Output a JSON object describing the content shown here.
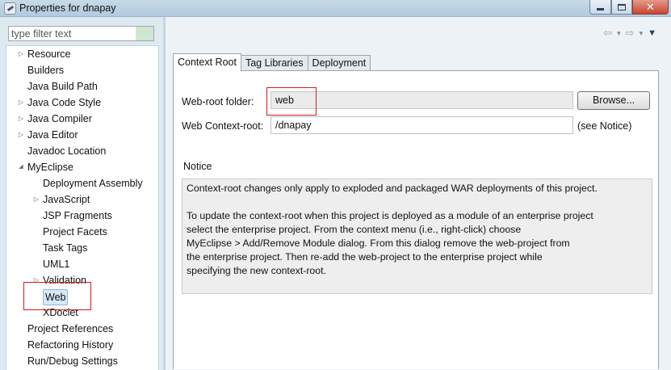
{
  "window": {
    "title": "Properties for dnapay"
  },
  "filter": {
    "placeholder": "type filter text"
  },
  "tree": {
    "items": [
      {
        "label": "Resource",
        "expander": "collapsed"
      },
      {
        "label": "Builders",
        "expander": "none"
      },
      {
        "label": "Java Build Path",
        "expander": "none"
      },
      {
        "label": "Java Code Style",
        "expander": "collapsed"
      },
      {
        "label": "Java Compiler",
        "expander": "collapsed"
      },
      {
        "label": "Java Editor",
        "expander": "collapsed"
      },
      {
        "label": "Javadoc Location",
        "expander": "none"
      },
      {
        "label": "MyEclipse",
        "expander": "expanded"
      },
      {
        "label": "Deployment Assembly",
        "expander": "none"
      },
      {
        "label": "JavaScript",
        "expander": "collapsed"
      },
      {
        "label": "JSP Fragments",
        "expander": "none"
      },
      {
        "label": "Project Facets",
        "expander": "none"
      },
      {
        "label": "Task Tags",
        "expander": "none"
      },
      {
        "label": "UML1",
        "expander": "none"
      },
      {
        "label": "Validation",
        "expander": "collapsed"
      },
      {
        "label": "Web",
        "expander": "none",
        "selected": true
      },
      {
        "label": "XDoclet",
        "expander": "none"
      },
      {
        "label": "Project References",
        "expander": "none"
      },
      {
        "label": "Refactoring History",
        "expander": "none"
      },
      {
        "label": "Run/Debug Settings",
        "expander": "none"
      }
    ]
  },
  "tabs": [
    {
      "label": "Context Root",
      "active": true
    },
    {
      "label": "Tag Libraries",
      "active": false
    },
    {
      "label": "Deployment",
      "active": false
    }
  ],
  "context_root": {
    "web_root_label": "Web-root folder:",
    "web_root_value": "web",
    "browse_label": "Browse...",
    "context_root_label": "Web Context-root:",
    "context_root_value": "/dnapay",
    "see_notice": "(see Notice)"
  },
  "notice": {
    "heading": "Notice",
    "para1": "Context-root changes only apply to exploded and packaged WAR deployments of this project.",
    "para2_lines": [
      "To update the context-root when this project is deployed as a module of an enterprise project",
      "select the enterprise project. From the context menu (i.e., right-click) choose",
      "MyEclipse > Add/Remove Module dialog. From this dialog remove the web-project from",
      "the enterprise project. Then re-add the web-project to the enterprise project while",
      "specifying the new context-root."
    ]
  },
  "icons": {
    "app": "eclipse-app-icon",
    "back": "back-arrow-icon",
    "forward": "forward-arrow-icon",
    "view_menu": "view-menu-icon"
  },
  "colors": {
    "annotation_red": "#d81a1a",
    "selection_fill": "#d5e8f7",
    "panel_bg": "#dfe9f0"
  }
}
